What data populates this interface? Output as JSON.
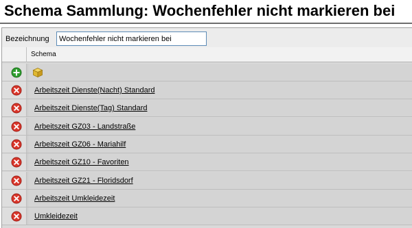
{
  "window": {
    "title": "Schema Sammlung: Wochenfehler nicht markieren bei"
  },
  "form": {
    "bezeichnung_label": "Bezeichnung",
    "bezeichnung_value": "Wochenfehler nicht markieren bei"
  },
  "grid": {
    "column_header": "Schema",
    "toolbar": {
      "add_icon": "add-icon",
      "cube_icon": "cube-icon"
    },
    "rows": [
      {
        "label": "Arbeitszeit Dienste(Nacht) Standard",
        "icon": "delete-icon"
      },
      {
        "label": "Arbeitszeit Dienste(Tag) Standard",
        "icon": "delete-icon"
      },
      {
        "label": "Arbeitszeit GZ03 - Landstraße",
        "icon": "delete-icon"
      },
      {
        "label": "Arbeitszeit GZ06 - Mariahilf",
        "icon": "delete-icon"
      },
      {
        "label": "Arbeitszeit GZ10 - Favoriten",
        "icon": "delete-icon"
      },
      {
        "label": "Arbeitszeit GZ21 - Floridsdorf",
        "icon": "delete-icon"
      },
      {
        "label": "Arbeitszeit Umkleidezeit",
        "icon": "delete-icon"
      },
      {
        "label": "Umkleidezeit",
        "icon": "delete-icon"
      }
    ]
  },
  "colors": {
    "delete_red": "#d9362b",
    "add_green": "#2f9e2f",
    "cube_gold": "#e0b830",
    "input_border": "#5c8bb7"
  }
}
